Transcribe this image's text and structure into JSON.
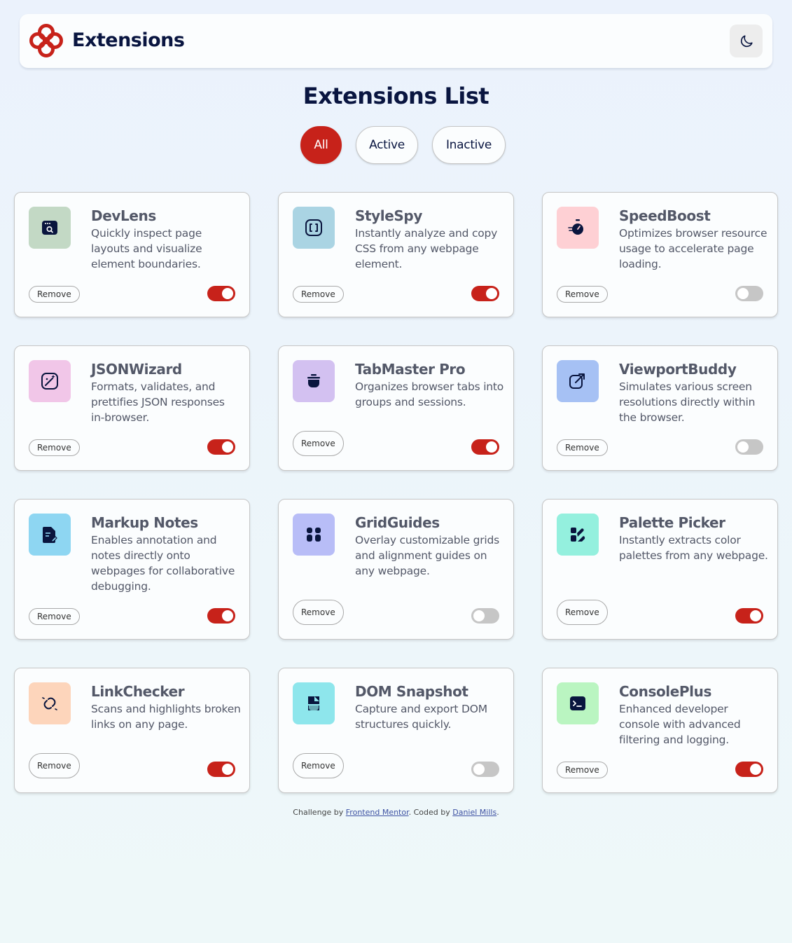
{
  "header": {
    "brand": "Extensions",
    "theme_toggle_icon": "moon-icon"
  },
  "page_title": "Extensions List",
  "filters": [
    {
      "label": "All",
      "selected": true
    },
    {
      "label": "Active",
      "selected": false
    },
    {
      "label": "Inactive",
      "selected": false
    }
  ],
  "remove_label": "Remove",
  "colors": {
    "accent": "#c7221a",
    "text_dark": "#091540",
    "text_body": "#535868",
    "toggle_off": "#c6c6c6"
  },
  "extensions": [
    {
      "name": "DevLens",
      "description": "Quickly inspect page layouts and visualize element boundaries.",
      "active": true,
      "icon": "browser-search-icon",
      "icon_bg": "#c3d9c5"
    },
    {
      "name": "StyleSpy",
      "description": "Instantly analyze and copy CSS from any webpage element.",
      "active": true,
      "icon": "brackets-icon",
      "icon_bg": "#aad4e3"
    },
    {
      "name": "SpeedBoost",
      "description": "Optimizes browser resource usage to accelerate page loading.",
      "active": false,
      "icon": "stopwatch-icon",
      "icon_bg": "#fed0d4"
    },
    {
      "name": "JSONWizard",
      "description": "Formats, validates, and prettifies JSON responses in-browser.",
      "active": true,
      "icon": "magic-wand-icon",
      "icon_bg": "#f1c6e8"
    },
    {
      "name": "TabMaster Pro",
      "description": "Organizes browser tabs into groups and sessions.",
      "active": true,
      "icon": "pot-icon",
      "icon_bg": "#d3c1f1"
    },
    {
      "name": "ViewportBuddy",
      "description": "Simulates various screen resolutions directly within the browser.",
      "active": false,
      "icon": "external-link-icon",
      "icon_bg": "#a6c1f4"
    },
    {
      "name": "Markup Notes",
      "description": "Enables annotation and notes directly onto webpages for collaborative debugging.",
      "active": true,
      "icon": "note-edit-icon",
      "icon_bg": "#8ed6f2"
    },
    {
      "name": "GridGuides",
      "description": "Overlay customizable grids and alignment guides on any webpage.",
      "active": false,
      "icon": "grid-icon",
      "icon_bg": "#b8bdf7"
    },
    {
      "name": "Palette Picker",
      "description": "Instantly extracts color palettes from any webpage.",
      "active": true,
      "icon": "palette-icon",
      "icon_bg": "#94f0de"
    },
    {
      "name": "LinkChecker",
      "description": "Scans and highlights broken links on any page.",
      "active": true,
      "icon": "broken-link-icon",
      "icon_bg": "#fdd5bb"
    },
    {
      "name": "DOM Snapshot",
      "description": "Capture and export DOM structures quickly.",
      "active": false,
      "icon": "snapshot-icon",
      "icon_bg": "#8ee6ec"
    },
    {
      "name": "ConsolePlus",
      "description": "Enhanced developer console with advanced filtering and logging.",
      "active": true,
      "icon": "terminal-icon",
      "icon_bg": "#baf5c1"
    }
  ],
  "footer": {
    "prefix": "Challenge by ",
    "link1": "Frontend Mentor",
    "middle": ". Coded by ",
    "link2": "Daniel Mills",
    "suffix": "."
  }
}
